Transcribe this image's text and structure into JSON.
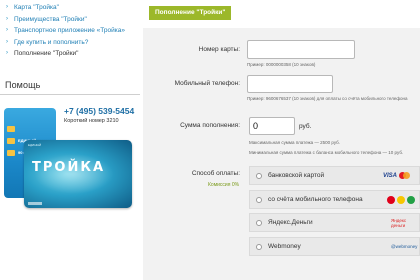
{
  "nav": {
    "items": [
      {
        "label": "Карта \"Тройка\""
      },
      {
        "label": "Преимущества \"Тройки\""
      },
      {
        "label": "Транспортное приложение «Тройка»"
      },
      {
        "label": "Где купить и пополнить?"
      },
      {
        "label": "Пополнение \"Тройки\""
      }
    ]
  },
  "help": {
    "title": "Помощь",
    "phone": "+7 (495) 539-5454",
    "short_number": "Короткий номер 3210"
  },
  "card": {
    "brand": "ТРОЙКА",
    "top_text": "ЕДИНЫЙ",
    "label_2": "ЕДИНЫЙ",
    "label_3": "90 минут"
  },
  "tab": {
    "label": "Пополнение \"Тройки\""
  },
  "form": {
    "card_number_label": "Номер карты:",
    "card_number_value": "",
    "card_number_hint": "Пример: 0000000358 (10 знаков)",
    "phone_label": "Мобильный телефон:",
    "phone_value": "",
    "phone_hint": "Пример: 9600676537 (10 знаков) для оплаты со счёта мобильного телефона",
    "amount_label": "Сумма пополнения:",
    "amount_value": "0",
    "currency": "руб.",
    "amount_hint_1": "Максимальная сумма платежа — 2500 руб.",
    "amount_hint_2": "Минимальная сумма платежа с баланса мобильного телефона — 10 руб.",
    "payment_label": "Способ оплаты:",
    "commission": "Комиссия 0%",
    "methods": [
      {
        "label": "банковской картой",
        "icons": [
          "visa-icon",
          "mastercard-icon"
        ]
      },
      {
        "label": "со счёта мобильного телефона",
        "icons": [
          "mts-icon",
          "beeline-icon",
          "megafon-icon"
        ]
      },
      {
        "label": "Яндекс.Деньги",
        "icons": [
          "yandex-money-icon"
        ]
      },
      {
        "label": "Webmoney",
        "icons": [
          "webmoney-icon"
        ]
      }
    ],
    "icon_text": {
      "visa": "VISA",
      "yandex": "Яндекс деньги",
      "webmoney": "@webmoney"
    }
  },
  "colors": {
    "tab_green": "#9cb82a",
    "link_blue": "#1f7fb5",
    "panel_bg": "#f2f2f2"
  }
}
